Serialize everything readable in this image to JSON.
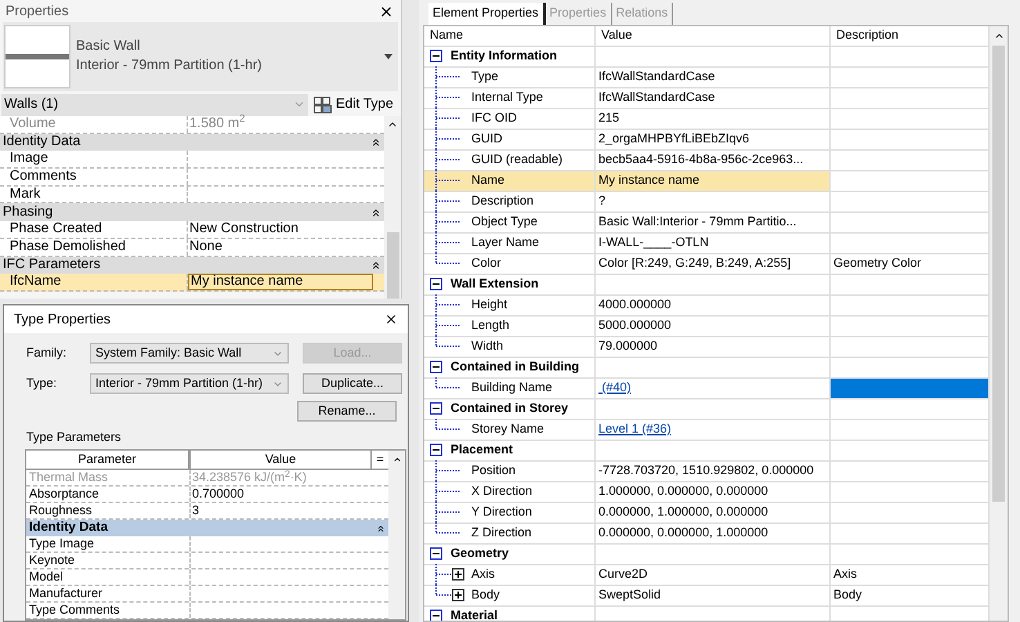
{
  "properties_panel": {
    "title": "Properties",
    "type_selector": {
      "family": "Basic Wall",
      "type": "Interior - 79mm Partition (1-hr)"
    },
    "filter": "Walls (1)",
    "edit_type_button": "Edit Type",
    "rows": [
      {
        "kind": "param",
        "name": "Volume",
        "value": "1.580 m$^{2}$",
        "disabled": true,
        "highlighted": false
      },
      {
        "kind": "header",
        "name": "Identity Data",
        "expanded": true
      },
      {
        "kind": "param",
        "name": "Image",
        "value": "",
        "disabled": false,
        "highlighted": false
      },
      {
        "kind": "param",
        "name": "Comments",
        "value": "",
        "disabled": false,
        "highlighted": false
      },
      {
        "kind": "param",
        "name": "Mark",
        "value": "",
        "disabled": false,
        "highlighted": false
      },
      {
        "kind": "header",
        "name": "Phasing",
        "expanded": true
      },
      {
        "kind": "param",
        "name": "Phase Created",
        "value": "New Construction",
        "disabled": false,
        "highlighted": false
      },
      {
        "kind": "param",
        "name": "Phase Demolished",
        "value": "None",
        "disabled": false,
        "highlighted": false
      },
      {
        "kind": "header",
        "name": "IFC Parameters",
        "expanded": true
      },
      {
        "kind": "param",
        "name": "IfcName",
        "value": "My instance name",
        "disabled": false,
        "highlighted": true
      }
    ]
  },
  "type_properties": {
    "title": "Type Properties",
    "family_label": "Family:",
    "family_value": "System Family: Basic Wall",
    "type_label": "Type:",
    "type_value": "Interior - 79mm Partition (1-hr)",
    "buttons": [
      {
        "label": "Load...",
        "disabled": true
      },
      {
        "label": "Duplicate...",
        "disabled": false
      },
      {
        "label": "Rename...",
        "disabled": false
      }
    ],
    "section_label": "Type Parameters",
    "columns": [
      "Parameter",
      "Value",
      "="
    ],
    "rows": [
      {
        "kind": "param",
        "name": "Thermal Mass",
        "value": "34.238576 kJ/(m$^{2}$·K)",
        "disabled": true
      },
      {
        "kind": "param",
        "name": "Absorptance",
        "value": "0.700000",
        "disabled": false
      },
      {
        "kind": "param",
        "name": "Roughness",
        "value": "3",
        "disabled": false
      },
      {
        "kind": "header",
        "name": "Identity Data",
        "expanded": true
      },
      {
        "kind": "param",
        "name": "Type Image",
        "value": "",
        "disabled": false
      },
      {
        "kind": "param",
        "name": "Keynote",
        "value": "",
        "disabled": false
      },
      {
        "kind": "param",
        "name": "Model",
        "value": "",
        "disabled": false
      },
      {
        "kind": "param",
        "name": "Manufacturer",
        "value": "",
        "disabled": false
      },
      {
        "kind": "param",
        "name": "Type Comments",
        "value": "",
        "disabled": false
      }
    ]
  },
  "element_properties": {
    "tabs": [
      {
        "label": "Element Properties",
        "selected": true
      },
      {
        "label": "Properties",
        "selected": false
      },
      {
        "label": "Relations",
        "selected": false
      }
    ],
    "columns": [
      "Name",
      "Value",
      "Description"
    ],
    "groups": [
      {
        "name": "Entity Information",
        "expanded": true,
        "rows": [
          {
            "kind": "leaf",
            "name": "Type",
            "value": "IfcWallStandardCase",
            "description": "",
            "link": false,
            "highlighted": false,
            "selected": false
          },
          {
            "kind": "leaf",
            "name": "Internal Type",
            "value": "IfcWallStandardCase",
            "description": "",
            "link": false,
            "highlighted": false,
            "selected": false
          },
          {
            "kind": "leaf",
            "name": "IFC OID",
            "value": "215",
            "description": "",
            "link": false,
            "highlighted": false,
            "selected": false
          },
          {
            "kind": "leaf",
            "name": "GUID",
            "value": "2_orgaMHPBYfLiBEbZIqv6",
            "description": "",
            "link": false,
            "highlighted": false,
            "selected": false
          },
          {
            "kind": "leaf",
            "name": "GUID (readable)",
            "value": "becb5aa4-5916-4b8a-956c-2ce963...",
            "description": "",
            "link": false,
            "highlighted": false,
            "selected": false
          },
          {
            "kind": "leaf",
            "name": "Name",
            "value": "My instance name",
            "description": "",
            "link": false,
            "highlighted": true,
            "selected": false
          },
          {
            "kind": "leaf",
            "name": "Description",
            "value": "?",
            "description": "",
            "link": false,
            "highlighted": false,
            "selected": false
          },
          {
            "kind": "leaf",
            "name": "Object Type",
            "value": "Basic Wall:Interior - 79mm Partitio...",
            "description": "",
            "link": false,
            "highlighted": false,
            "selected": false
          },
          {
            "kind": "leaf",
            "name": "Layer Name",
            "value": "I-WALL-____-OTLN",
            "description": "",
            "link": false,
            "highlighted": false,
            "selected": false
          },
          {
            "kind": "leaf",
            "name": "Color",
            "value": "Color [R:249, G:249, B:249, A:255]",
            "description": "Geometry Color",
            "link": false,
            "highlighted": false,
            "selected": false
          }
        ]
      },
      {
        "name": "Wall Extension",
        "expanded": true,
        "rows": [
          {
            "kind": "leaf",
            "name": "Height",
            "value": "4000.000000",
            "description": "",
            "link": false,
            "highlighted": false,
            "selected": false
          },
          {
            "kind": "leaf",
            "name": "Length",
            "value": "5000.000000",
            "description": "",
            "link": false,
            "highlighted": false,
            "selected": false
          },
          {
            "kind": "leaf",
            "name": "Width",
            "value": "79.000000",
            "description": "",
            "link": false,
            "highlighted": false,
            "selected": false
          }
        ]
      },
      {
        "name": "Contained in Building",
        "expanded": true,
        "rows": [
          {
            "kind": "leaf",
            "name": "Building Name",
            "value": " (#40)",
            "description": "",
            "link": true,
            "highlighted": false,
            "selected": true
          }
        ]
      },
      {
        "name": "Contained in Storey",
        "expanded": true,
        "rows": [
          {
            "kind": "leaf",
            "name": "Storey Name",
            "value": "Level 1 (#36)",
            "description": "",
            "link": true,
            "highlighted": false,
            "selected": false
          }
        ]
      },
      {
        "name": "Placement",
        "expanded": true,
        "rows": [
          {
            "kind": "leaf",
            "name": "Position",
            "value": "-7728.703720, 1510.929802, 0.000000",
            "description": "",
            "link": false,
            "highlighted": false,
            "selected": false
          },
          {
            "kind": "leaf",
            "name": "X Direction",
            "value": "1.000000, 0.000000, 0.000000",
            "description": "",
            "link": false,
            "highlighted": false,
            "selected": false
          },
          {
            "kind": "leaf",
            "name": "Y Direction",
            "value": "0.000000, 1.000000, 0.000000",
            "description": "",
            "link": false,
            "highlighted": false,
            "selected": false
          },
          {
            "kind": "leaf",
            "name": "Z Direction",
            "value": "0.000000, 0.000000, 1.000000",
            "description": "",
            "link": false,
            "highlighted": false,
            "selected": false
          }
        ]
      },
      {
        "name": "Geometry",
        "expanded": true,
        "rows": [
          {
            "kind": "node",
            "expanded": false,
            "name": "Axis",
            "value": "Curve2D",
            "description": "Axis",
            "link": false,
            "highlighted": false,
            "selected": false
          },
          {
            "kind": "node",
            "expanded": false,
            "name": "Body",
            "value": "SweptSolid",
            "description": "Body",
            "link": false,
            "highlighted": false,
            "selected": false
          }
        ]
      },
      {
        "name": "Material",
        "expanded": true
      }
    ]
  }
}
